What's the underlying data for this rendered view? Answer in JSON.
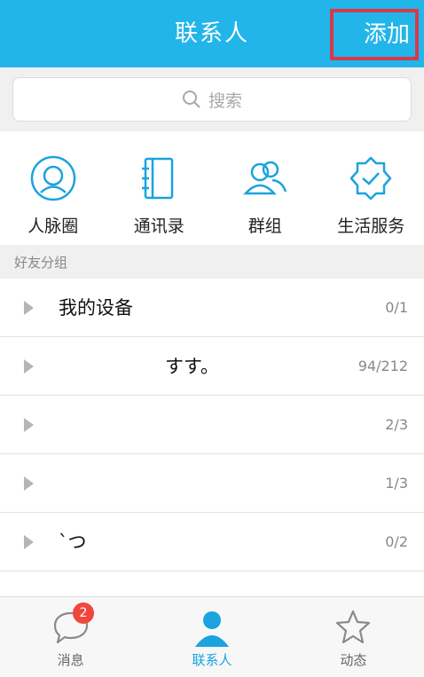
{
  "header": {
    "title": "联系人",
    "add_label": "添加"
  },
  "search": {
    "placeholder": "搜索"
  },
  "quick_actions": [
    {
      "label": "人脉圈",
      "icon": "person-circle-icon"
    },
    {
      "label": "通讯录",
      "icon": "address-book-icon"
    },
    {
      "label": "群组",
      "icon": "group-icon"
    },
    {
      "label": "生活服务",
      "icon": "badge-check-icon"
    }
  ],
  "section": {
    "label": "好友分组"
  },
  "groups": [
    {
      "name": "我的设备",
      "count": "0/1"
    },
    {
      "name": "すす。",
      "count": "94/212"
    },
    {
      "name": "",
      "count": "2/3"
    },
    {
      "name": "",
      "count": "1/3"
    },
    {
      "name": "ˋつ",
      "count": "0/2"
    }
  ],
  "tabs": [
    {
      "label": "消息",
      "badge": "2",
      "icon": "chat-bubble-icon"
    },
    {
      "label": "联系人",
      "icon": "contact-person-icon"
    },
    {
      "label": "动态",
      "icon": "star-icon"
    }
  ],
  "colors": {
    "accent": "#22b5ea",
    "highlight_border": "#d8394a",
    "badge": "#f0473c"
  }
}
